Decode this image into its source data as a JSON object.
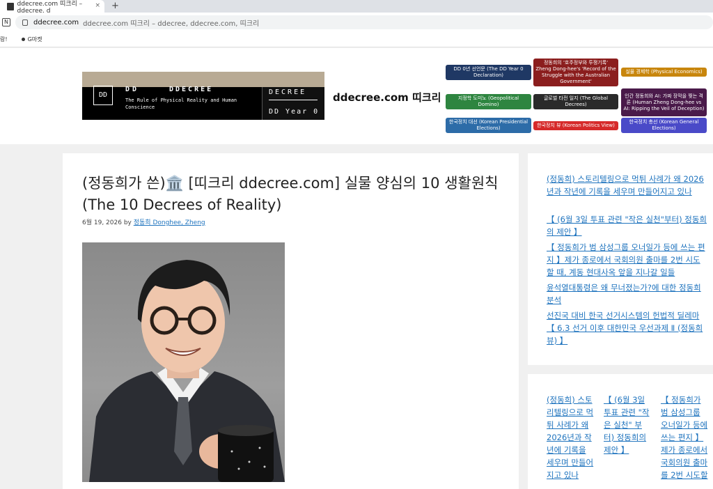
{
  "browser": {
    "tab_title": "ddecree.com 띠크리 – ddecree, d",
    "tab_close": "×",
    "new_tab": "+",
    "nav_icon": "N",
    "url_domain": "ddecree.com",
    "url_rest": "ddecree.com 띠크리 – ddecree, ddecree.com, 띠크리",
    "bookmark_1": "랑!",
    "bookmark_2": "G마켓"
  },
  "header": {
    "logo": {
      "box": "DD",
      "title_a": "DD",
      "title_b": "DDECREE",
      "tagline": "The Rule of Physical Reality and Human Conscience",
      "right_top": "DECREE",
      "right_bottom": "DD Year 0"
    },
    "site_title": "ddecree.com 띠크리",
    "badges": [
      {
        "label": "DD 0년 선언문 (The DD Year 0 Declaration)",
        "color": "#1f3864"
      },
      {
        "label": "정동희의 '호주정부와 투쟁기록' Zheng Dong-hee's 'Record of the Struggle with the Australian Government'",
        "color": "#8b1e1e"
      },
      {
        "label": "실물 경제학 (Physical Economics)",
        "color": "#c8860d"
      },
      {
        "label": "지정학 도미노 (Geopolitical Domino)",
        "color": "#2e8540"
      },
      {
        "label": "글로벌 타전 일지 (The Global Decrees)",
        "color": "#2a2a2a"
      },
      {
        "label": "인간 정동희와 AI: 가짜 장막을 찢는 격론 (Human Zheng Dong-hee vs AI: Ripping the Veil of Deception)",
        "color": "#4a1a4a"
      },
      {
        "label": "한국정치 대선 (Korean Presidential Elections)",
        "color": "#2d6ca8"
      },
      {
        "label": "한국정치 뷰 (Korean Politics View)",
        "color": "#d62a2a"
      },
      {
        "label": "한국정치 총선 (Korean General Elections)",
        "color": "#4a4ac8"
      }
    ]
  },
  "post": {
    "title": "(정동희가 쓴)🏛️ [띠크리 ddecree.com] 실물 양심의 10 생활원칙 (The 10 Decrees of Reality)",
    "date": "6월 19, 2026",
    "by": "by",
    "author": "정동희 Donghee, Zheng"
  },
  "sidebar": {
    "recent": [
      "(정동희) 스토리텔링으로 먹튀 사례가 왜 2026년과 작년에 기록을 세우며 만들어지고 있나",
      "【 (6월 3일 투표 관련 \"작은 실천\"부터) 정동희의 제안 】",
      "【 정동희가 범 삼성그룹 오너일가 등에 쓰는 편지 】제가 종로에서 국회의원 출마를 2번 시도할 때, 계동 현대사옥 앞을 지나갈 일들",
      "윤석열대통령은 왜 무너졌는가?에 대한 정동희 분석",
      "선진국 대비 한국 선거시스템의 헌법적 딜레마 【 6.3 선거 이후 대한민국 우선과제 Ⅱ (정동희 뷰) 】"
    ],
    "columns": [
      "(정동희) 스토리텔링으로 먹튀 사례가 왜 2026년과 작년에 기록을 세우며 만들어지고 있나",
      "【 (6월 3일 투표 관련 \"작은 실천\" 부터) 정동희의 제안 】",
      "【 정동희가 범 삼성그룹 오너일가 등에 쓰는 편지 】제가 종로에서 국회의원 출마를 2번 시도할"
    ]
  }
}
